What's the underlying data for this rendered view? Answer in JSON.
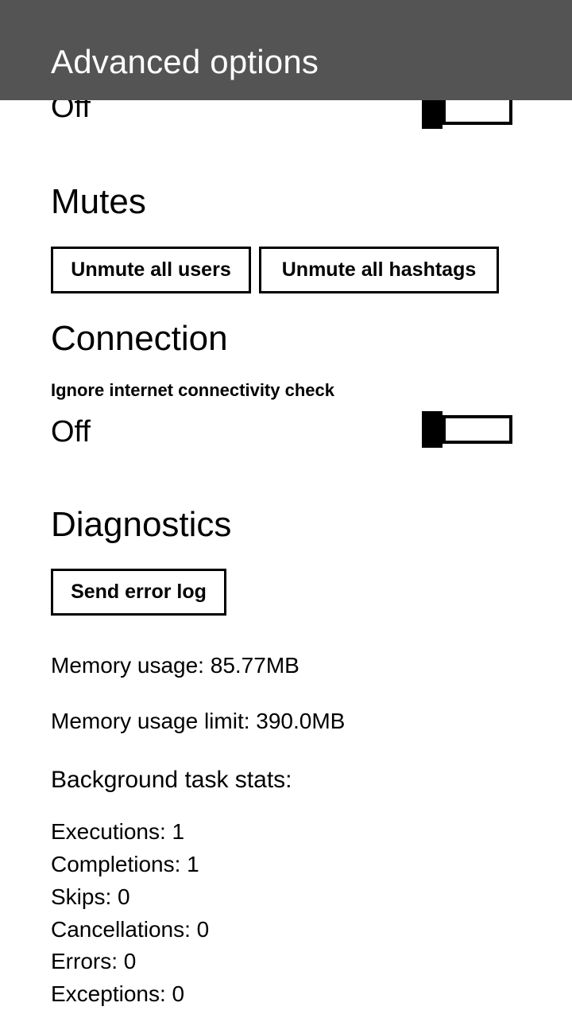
{
  "header": {
    "title": "Advanced options",
    "background_color": "#545454",
    "text_color": "#ffffff"
  },
  "clipped_top_row": {
    "value": "Off",
    "toggle_state": "off"
  },
  "sections": {
    "mutes": {
      "title": "Mutes",
      "buttons": [
        {
          "label": "Unmute all users",
          "name": "unmute-all-users-button"
        },
        {
          "label": "Unmute all hashtags",
          "name": "unmute-all-hashtags-button"
        }
      ]
    },
    "connection": {
      "title": "Connection",
      "setting_label": "Ignore internet connectivity check",
      "setting_value": "Off",
      "toggle_state": "off"
    },
    "diagnostics": {
      "title": "Diagnostics",
      "send_error_log_label": "Send error log",
      "memory_usage": "Memory usage: 85.77MB",
      "memory_usage_limit": "Memory usage limit: 390.0MB",
      "background_task_stats_title": "Background task stats:",
      "stats": [
        "Executions: 1",
        "Completions: 1",
        "Skips: 0",
        "Cancellations: 0",
        "Errors: 0",
        "Exceptions: 0"
      ]
    }
  },
  "colors": {
    "accent": "#000000",
    "page_background": "#ffffff",
    "header_background": "#545454"
  }
}
